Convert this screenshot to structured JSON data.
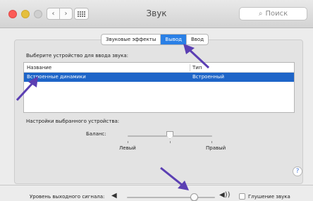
{
  "window": {
    "title": "Звук",
    "search_placeholder": "Поиск"
  },
  "tabs": [
    {
      "label": "Звуковые эффекты",
      "active": false
    },
    {
      "label": "Вывод",
      "active": true
    },
    {
      "label": "Ввод",
      "active": false
    }
  ],
  "device_section": {
    "prompt": "Выберите устройство для ввода звука:",
    "columns": {
      "name": "Название",
      "type": "Тип"
    },
    "rows": [
      {
        "name": "Встроенные динамики",
        "type": "Встроенный",
        "selected": true
      }
    ]
  },
  "settings": {
    "heading": "Настройки выбранного устройства:",
    "balance_label": "Баланс:",
    "left_label": "Левый",
    "right_label": "Правый",
    "balance_value": 0.5
  },
  "output": {
    "label": "Уровень выходного сигнала:",
    "volume_level": 0.76,
    "mute_label": "Глушение звука",
    "mute_checked": false
  },
  "help_label": "?",
  "colors": {
    "accent": "#2a80e6",
    "selection": "#1e65c8",
    "annotation_arrow": "#5b3fb3"
  }
}
